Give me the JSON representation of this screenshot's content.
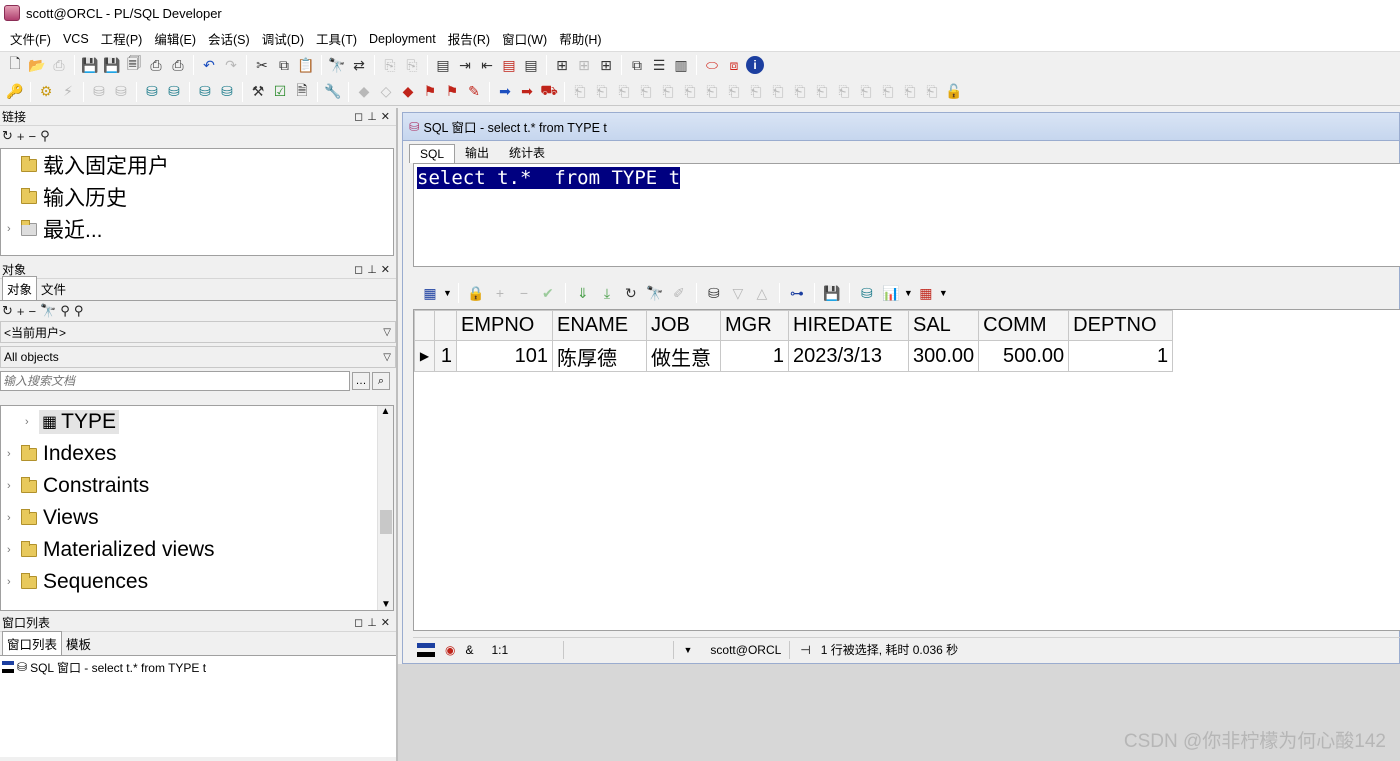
{
  "window": {
    "title": "scott@ORCL - PL/SQL Developer"
  },
  "menu": [
    "文件(F)",
    "VCS",
    "工程(P)",
    "编辑(E)",
    "会话(S)",
    "调试(D)",
    "工具(T)",
    "Deployment",
    "报告(R)",
    "窗口(W)",
    "帮助(H)"
  ],
  "connections_panel": {
    "title": "链接",
    "items": [
      {
        "label": "载入固定用户"
      },
      {
        "label": "输入历史"
      },
      {
        "label": "最近..."
      }
    ]
  },
  "objects_panel": {
    "title": "对象",
    "tabs": [
      "对象",
      "文件"
    ],
    "user_combo": "<当前用户>",
    "filter_combo": "All objects",
    "search_placeholder": "输入搜索文档",
    "items": [
      {
        "label": "TYPE",
        "kind": "table",
        "selected": true
      },
      {
        "label": "Indexes"
      },
      {
        "label": "Constraints"
      },
      {
        "label": "Views"
      },
      {
        "label": "Materialized views"
      },
      {
        "label": "Sequences"
      }
    ]
  },
  "windowlist_panel": {
    "title": "窗口列表",
    "tabs": [
      "窗口列表",
      "模板"
    ],
    "entry": "SQL 窗口 - select t.* from TYPE t"
  },
  "sql_window": {
    "title": "SQL 窗口 - select t.* from TYPE t",
    "tabs": [
      "SQL",
      "输出",
      "统计表"
    ],
    "sql_text": "select t.*  from TYPE t",
    "grid": {
      "columns": [
        "EMPNO",
        "ENAME",
        "JOB",
        "MGR",
        "HIREDATE",
        "SAL",
        "COMM",
        "DEPTNO"
      ],
      "rows": [
        {
          "num": "1",
          "cells": [
            "101",
            "陈厚德",
            "做生意",
            "1",
            "2023/3/13",
            "300.00",
            "500.00",
            "1"
          ]
        }
      ]
    },
    "status": {
      "position": "1:1",
      "connection": "scott@ORCL",
      "message": "1 行被选择, 耗时 0.036 秒"
    }
  },
  "watermark": "CSDN @你非柠檬为何心酸142"
}
